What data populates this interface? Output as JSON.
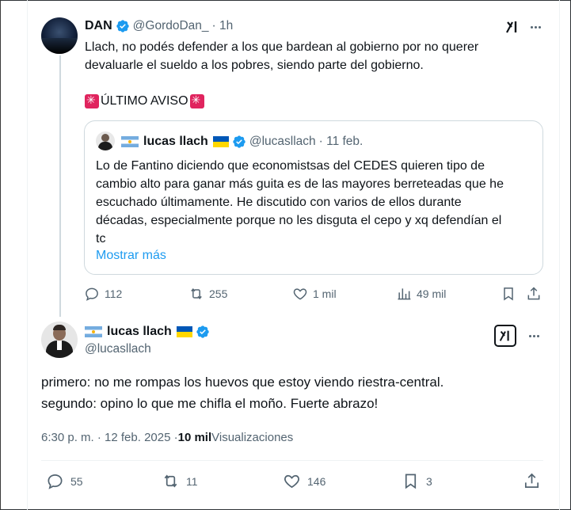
{
  "tweet1": {
    "name": "DAN",
    "handle": "@GordoDan_",
    "time": "· 1h",
    "text_line1": "Llach, no podés defender a los que bardean al gobierno por no querer",
    "text_line2": "devaluarle el sueldo a los pobres, siendo parte del gobierno.",
    "warning": "ÚLTIMO AVISO",
    "quote": {
      "name": "lucas llach",
      "handle": "@lucasllach",
      "date": "· 11 feb.",
      "lines": [
        "Lo de Fantino diciendo que economistsas del CEDES quieren tipo de",
        "cambio alto para ganar más guita es de las mayores berreteadas que he",
        "escuchado últimamente. He discutido con varios de ellos durante",
        "décadas, especialmente porque no les disguta el cepo y xq defendían el",
        "tc"
      ],
      "show_more": "Mostrar más"
    },
    "actions": {
      "replies": "112",
      "reposts": "255",
      "likes": "1 mil",
      "views": "49 mil"
    }
  },
  "tweet2": {
    "name": "lucas llach",
    "handle": "@lucasllach",
    "line1": "primero: no me rompas los huevos que estoy viendo riestra-central.",
    "line2": "segundo: opino lo que me chifla el moño. Fuerte abrazo!",
    "timestamp": "6:30 p. m. · 12 feb. 2025 · ",
    "views_count": "10 mil",
    "views_label": " Visualizaciones",
    "actions": {
      "replies": "55",
      "reposts": "11",
      "likes": "146",
      "bookmarks": "3"
    }
  },
  "colors": {
    "verified": "#1d9bf0",
    "muted": "#536471",
    "link": "#1d9bf0"
  },
  "icons": [
    "verified-icon",
    "grok-icon",
    "more-icon",
    "reply-icon",
    "repost-icon",
    "like-icon",
    "views-icon",
    "bookmark-icon",
    "share-icon"
  ]
}
